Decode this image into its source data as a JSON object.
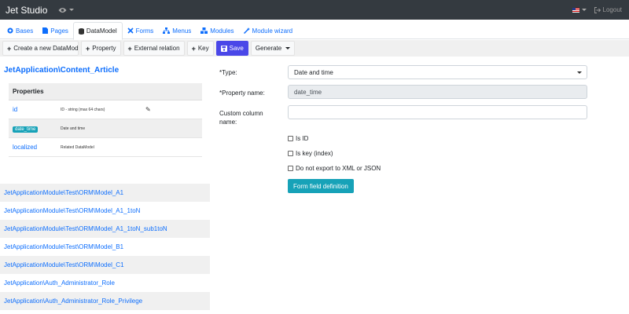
{
  "navbar": {
    "brand": "Jet Studio",
    "eye_icon": "eye-icon",
    "language_icon": "us-flag-icon",
    "logout_label": "Logout"
  },
  "tabs": [
    {
      "label": "Bases",
      "icon": "bases-icon",
      "active": false
    },
    {
      "label": "Pages",
      "icon": "page-icon",
      "active": false
    },
    {
      "label": "DataModel",
      "icon": "database-icon",
      "active": true
    },
    {
      "label": "Forms",
      "icon": "forms-icon",
      "active": false
    },
    {
      "label": "Menus",
      "icon": "menu-tree-icon",
      "active": false
    },
    {
      "label": "Modules",
      "icon": "modules-icon",
      "active": false
    },
    {
      "label": "Module wizard",
      "icon": "wand-icon",
      "active": false
    }
  ],
  "toolbar": {
    "create_label": "Create a new DataModel",
    "property_label": "Property",
    "external_label": "External relation",
    "key_label": "Key",
    "save_label": "Save",
    "generate_label": "Generate"
  },
  "model": {
    "title": "JetApplication\\Content_Article",
    "properties_header": "Properties",
    "properties": [
      {
        "name": "id",
        "description": "ID - string (max 64 chars)",
        "badge": false
      },
      {
        "name": "date_time",
        "description": "Date and time",
        "badge": true
      },
      {
        "name": "localized",
        "description": "Related DataModel",
        "badge": false
      }
    ]
  },
  "model_list": [
    "JetApplicationModule\\Test\\ORM\\Model_A1",
    "JetApplicationModule\\Test\\ORM\\Model_A1_1toN",
    "JetApplicationModule\\Test\\ORM\\Model_A1_1toN_sub1toN",
    "JetApplicationModule\\Test\\ORM\\Model_B1",
    "JetApplicationModule\\Test\\ORM\\Model_C1",
    "JetApplication\\Auth_Administrator_Role",
    "JetApplication\\Auth_Administrator_Role_Privilege"
  ],
  "form": {
    "type_label": "*Type:",
    "type_value": "Date and time",
    "property_name_label": "*Property name:",
    "property_name_value": "date_time",
    "custom_column_label": "Custom column name:",
    "custom_column_value": "",
    "is_id_label": "Is ID",
    "is_key_label": "Is key (index)",
    "no_export_label": "Do not export to XML or JSON",
    "form_field_button": "Form field definition"
  },
  "colors": {
    "navbar": "#343a40",
    "link": "#0d6efd",
    "save": "#4a47e8",
    "info": "#17a2b8"
  }
}
